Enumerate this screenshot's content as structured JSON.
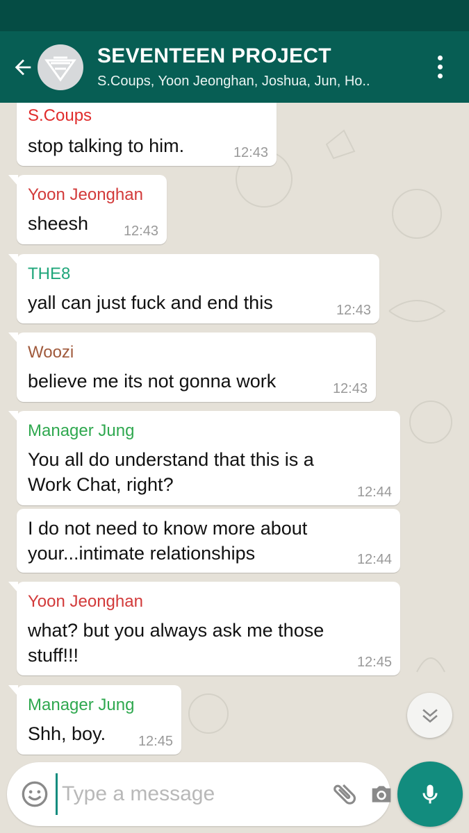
{
  "header": {
    "title": "SEVENTEEN PROJECT",
    "subtitle": "S.Coups, Yoon Jeonghan, Joshua, Jun, Ho.."
  },
  "messages": [
    {
      "sender": "S.Coups",
      "sender_color": "#e02c2c",
      "text": "stop talking to him.",
      "time": "12:43"
    },
    {
      "sender": "Yoon Jeonghan",
      "sender_color": "#d23a3a",
      "text": "sheesh",
      "time": "12:43"
    },
    {
      "sender": "THE8",
      "sender_color": "#1fa67a",
      "text": "yall can just fuck and end this",
      "time": "12:43"
    },
    {
      "sender": "Woozi",
      "sender_color": "#a05a3c",
      "text": "believe me its not gonna work",
      "time": "12:43"
    },
    {
      "sender": "Manager Jung",
      "sender_color": "#2fa84f",
      "text_lines": [
        "You all do understand that this is a",
        "Work Chat, right?"
      ],
      "time": "12:44"
    },
    {
      "sender": "",
      "text_lines": [
        "I do not need to know more about",
        "your...intimate relationships"
      ],
      "time": "12:44"
    },
    {
      "sender": "Yoon Jeonghan",
      "sender_color": "#d23a3a",
      "text_lines": [
        "what? but you always ask me those",
        "stuff!!!"
      ],
      "time": "12:45"
    },
    {
      "sender": "Manager Jung",
      "sender_color": "#2fa84f",
      "text": "Shh, boy.",
      "time": "12:45"
    }
  ],
  "input": {
    "placeholder": "Type a message"
  },
  "icons": {
    "back": "arrow-left-icon",
    "menu": "more-vert-icon",
    "scroll": "chevron-double-down-icon",
    "emoji": "smiley-icon",
    "attach": "paperclip-icon",
    "camera": "camera-icon",
    "mic": "microphone-icon"
  },
  "colors": {
    "header": "#075e54",
    "status_bar": "#054c44",
    "accent": "#128c7e",
    "chat_background": "#e5e1d8"
  }
}
